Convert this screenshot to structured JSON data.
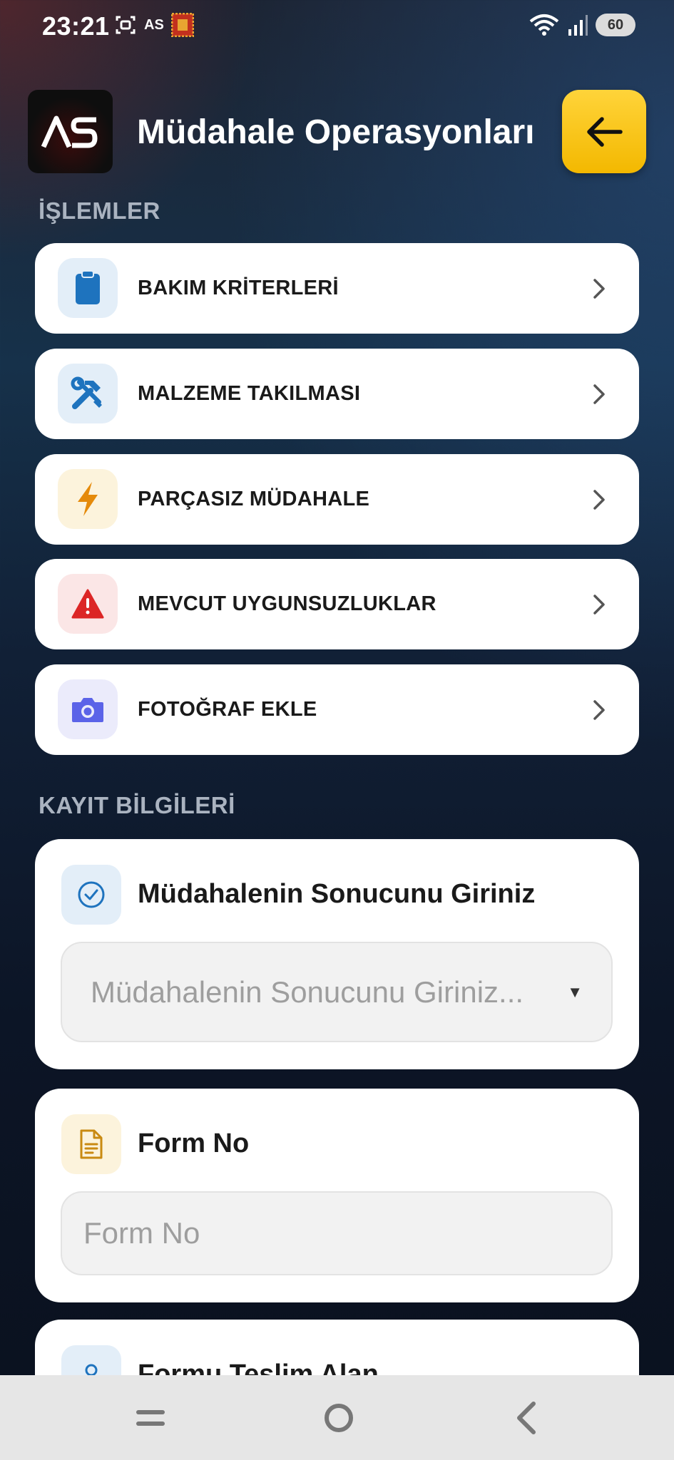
{
  "status_bar": {
    "time": "23:21",
    "as_label": "AS",
    "battery": "60"
  },
  "header": {
    "logo_text": "AS",
    "title": "Müdahale Operasyonları"
  },
  "sections": {
    "operations_label": "İŞLEMLER",
    "records_label": "KAYIT BİLGİLERİ"
  },
  "menu": [
    {
      "label": "BAKIM KRİTERLERİ",
      "icon": "clipboard-icon",
      "icon_color": "#1e73be",
      "bg": "#e3eef8"
    },
    {
      "label": "MALZEME TAKILMASI",
      "icon": "tools-icon",
      "icon_color": "#1e73be",
      "bg": "#e3eef8"
    },
    {
      "label": "PARÇASIZ MÜDAHALE",
      "icon": "bolt-icon",
      "icon_color": "#e58a0a",
      "bg": "#fcf3dc"
    },
    {
      "label": "MEVCUT UYGUNSUZLUKLAR",
      "icon": "warning-icon",
      "icon_color": "#dc2626",
      "bg": "#fbe6e6"
    },
    {
      "label": "FOTOĞRAF EKLE",
      "icon": "camera-icon",
      "icon_color": "#5b63e8",
      "bg": "#ebebfb"
    }
  ],
  "form": {
    "result": {
      "title": "Müdahalenin Sonucunu Giriniz",
      "placeholder": "Müdahalenin Sonucunu Giriniz..."
    },
    "form_no": {
      "title": "Form No",
      "placeholder": "Form No"
    },
    "receiver": {
      "title": "Formu Teslim Alan"
    }
  },
  "colors": {
    "accent_yellow": "#f5c000",
    "card_bg": "#ffffff"
  }
}
